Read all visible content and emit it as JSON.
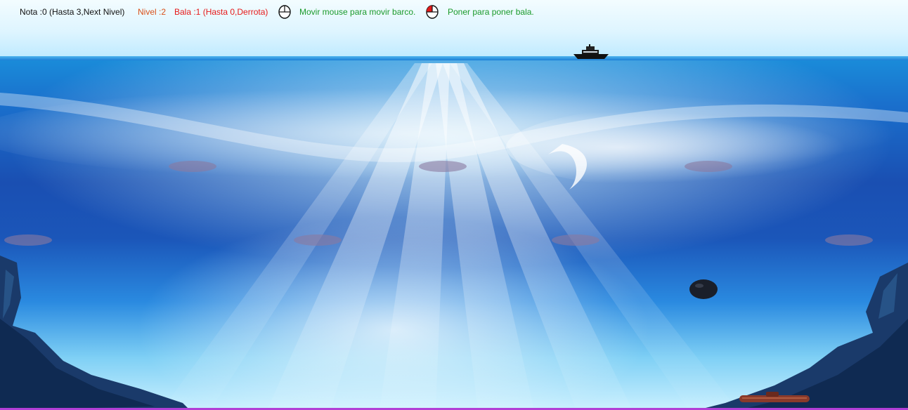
{
  "hud": {
    "score_text": "Nota :0 (Hasta 3,Next Nivel)",
    "level_text": "Nivel :2",
    "bullets_text": "Bala :1 (Hasta 0,Derrota)",
    "move_hint": "Movir mouse para movir barco.",
    "fire_hint": "Poner para poner bala.",
    "move_icon": "mouse-icon",
    "fire_icon": "mouse-left-click-icon"
  },
  "colors": {
    "score": "#111111",
    "level": "#d9501a",
    "bullets": "#e61919",
    "hints": "#1a9a2a",
    "click_highlight": "#e11a1a",
    "border": "#b23fd6"
  },
  "scene": {
    "player": "ship-icon",
    "enemy": "submarine-icon",
    "projectile": "mine-icon",
    "obstacle": "coral-reef-triangle"
  }
}
